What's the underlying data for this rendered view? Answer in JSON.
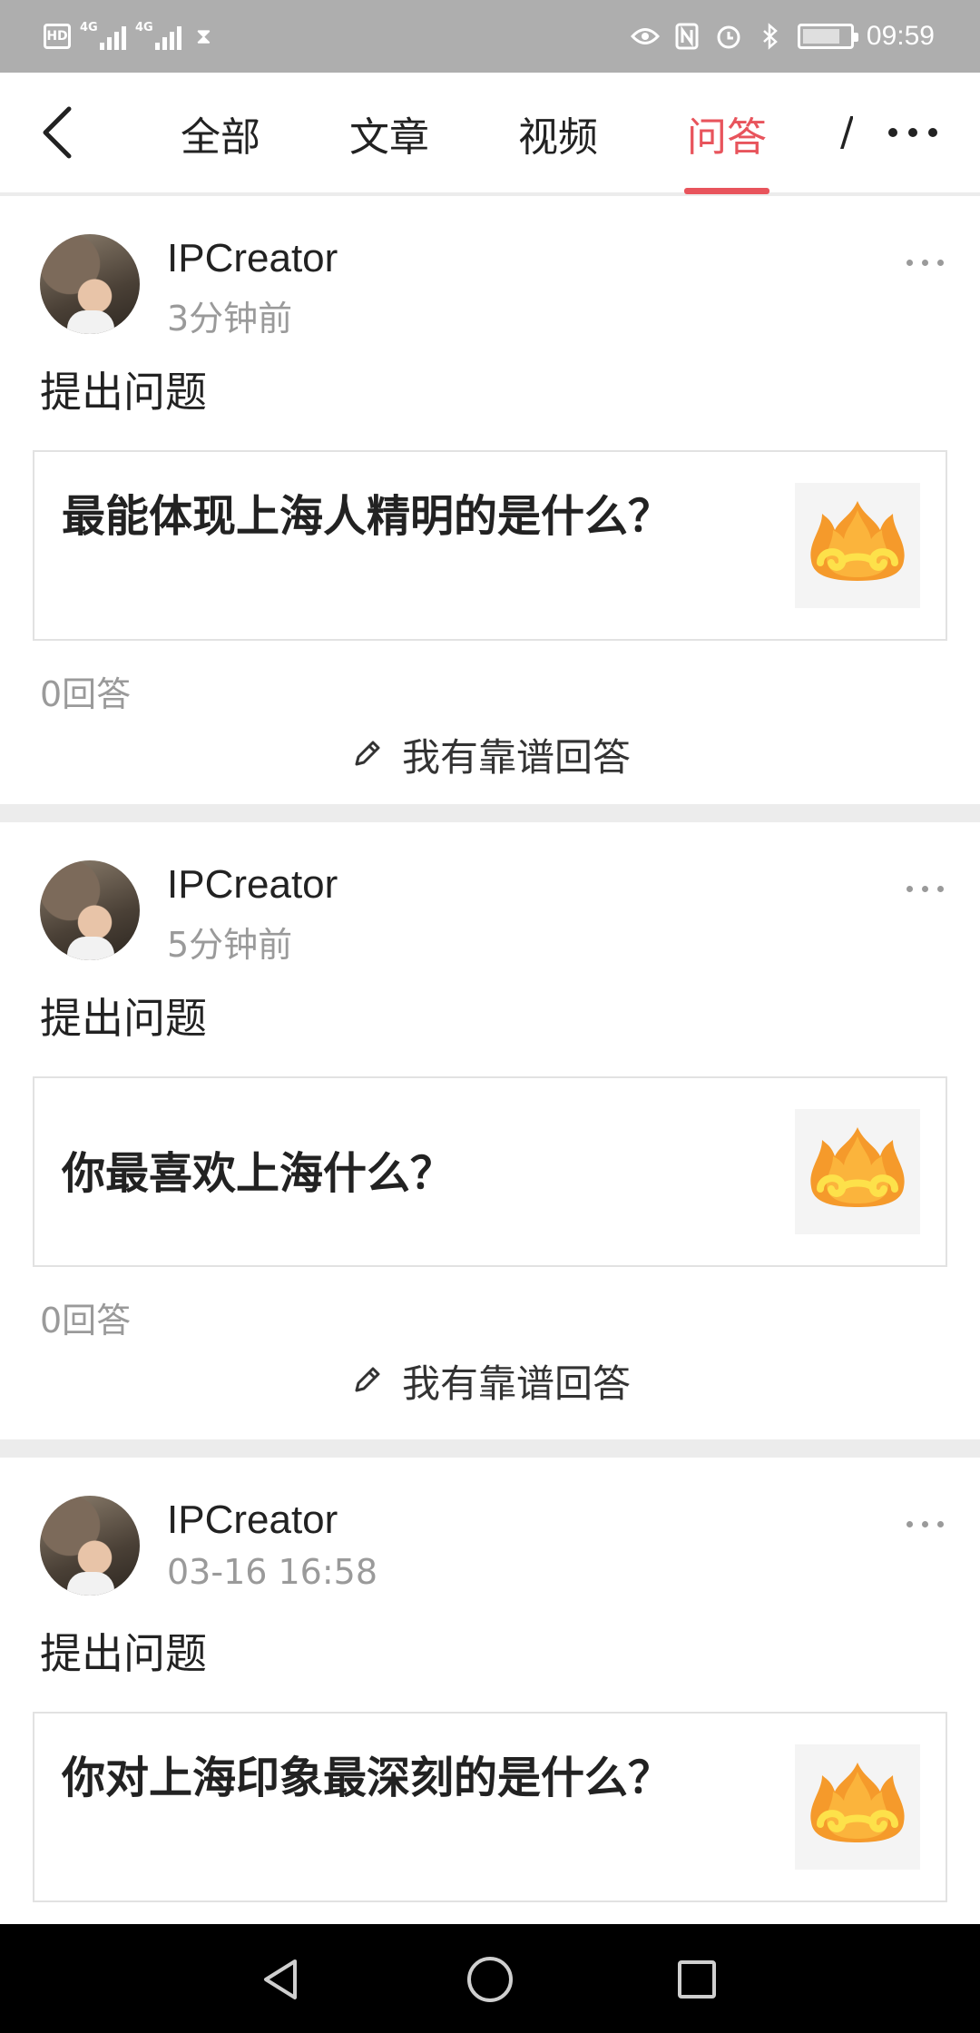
{
  "status_bar": {
    "left_icons": [
      "hd-icon",
      "signal-4g-icon",
      "signal-4g-icon",
      "hourglass-icon"
    ],
    "right_icons": [
      "eye-icon",
      "nfc-icon",
      "alarm-icon",
      "bluetooth-icon",
      "battery-icon"
    ],
    "time": "09:59"
  },
  "header": {
    "tabs": [
      {
        "label": "全部"
      },
      {
        "label": "文章"
      },
      {
        "label": "视频"
      },
      {
        "label": "问答"
      }
    ],
    "active_tab": "问答",
    "accent_color": "#e8545c"
  },
  "cards": [
    {
      "username": "IPCreator",
      "time": "3分钟前",
      "action": "提出问题",
      "question": "最能体现上海人精明的是什么？",
      "answers": "0回答",
      "answer_button": "我有靠谱回答"
    },
    {
      "username": "IPCreator",
      "time": "5分钟前",
      "action": "提出问题",
      "question": "你最喜欢上海什么？",
      "answers": "0回答",
      "answer_button": "我有靠谱回答"
    },
    {
      "username": "IPCreator",
      "time": "03-16 16:58",
      "action": "提出问题",
      "question": "你对上海印象最深刻的是什么？"
    }
  ]
}
